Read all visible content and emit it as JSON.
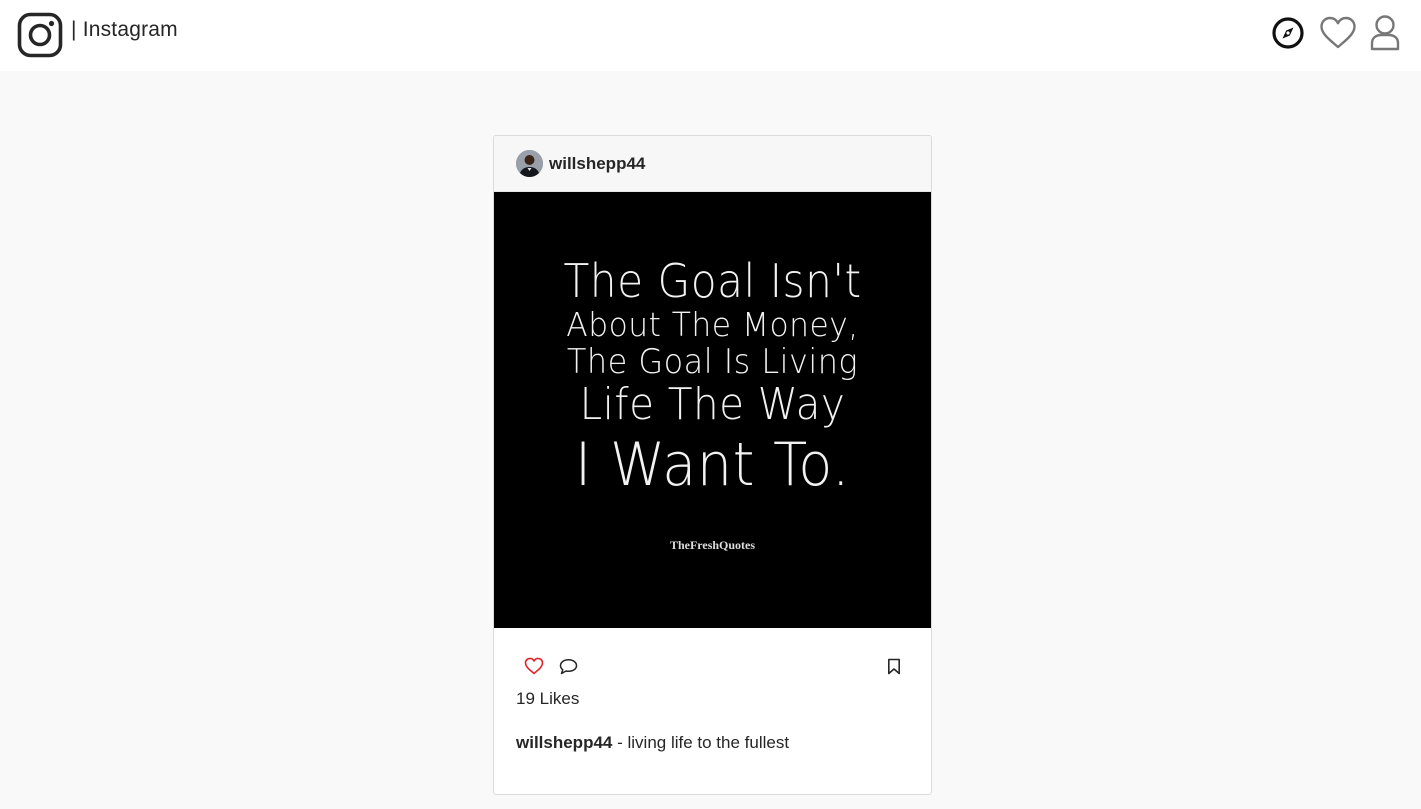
{
  "app": {
    "brand_separator": "| Instagram"
  },
  "nav": {
    "icons": [
      "compass-icon",
      "heart-icon",
      "profile-icon"
    ]
  },
  "post": {
    "username": "willshepp44",
    "image": {
      "quote_lines": [
        "The Goal Isn't",
        "About The Money,",
        "The Goal Is Living",
        "Life The Way",
        "I Want To."
      ],
      "watermark": "TheFreshQuotes"
    },
    "likes_text": "19 Likes",
    "caption_user": "willshepp44",
    "caption_text": " - living life to the fullest",
    "like_color": "#e5212c"
  }
}
